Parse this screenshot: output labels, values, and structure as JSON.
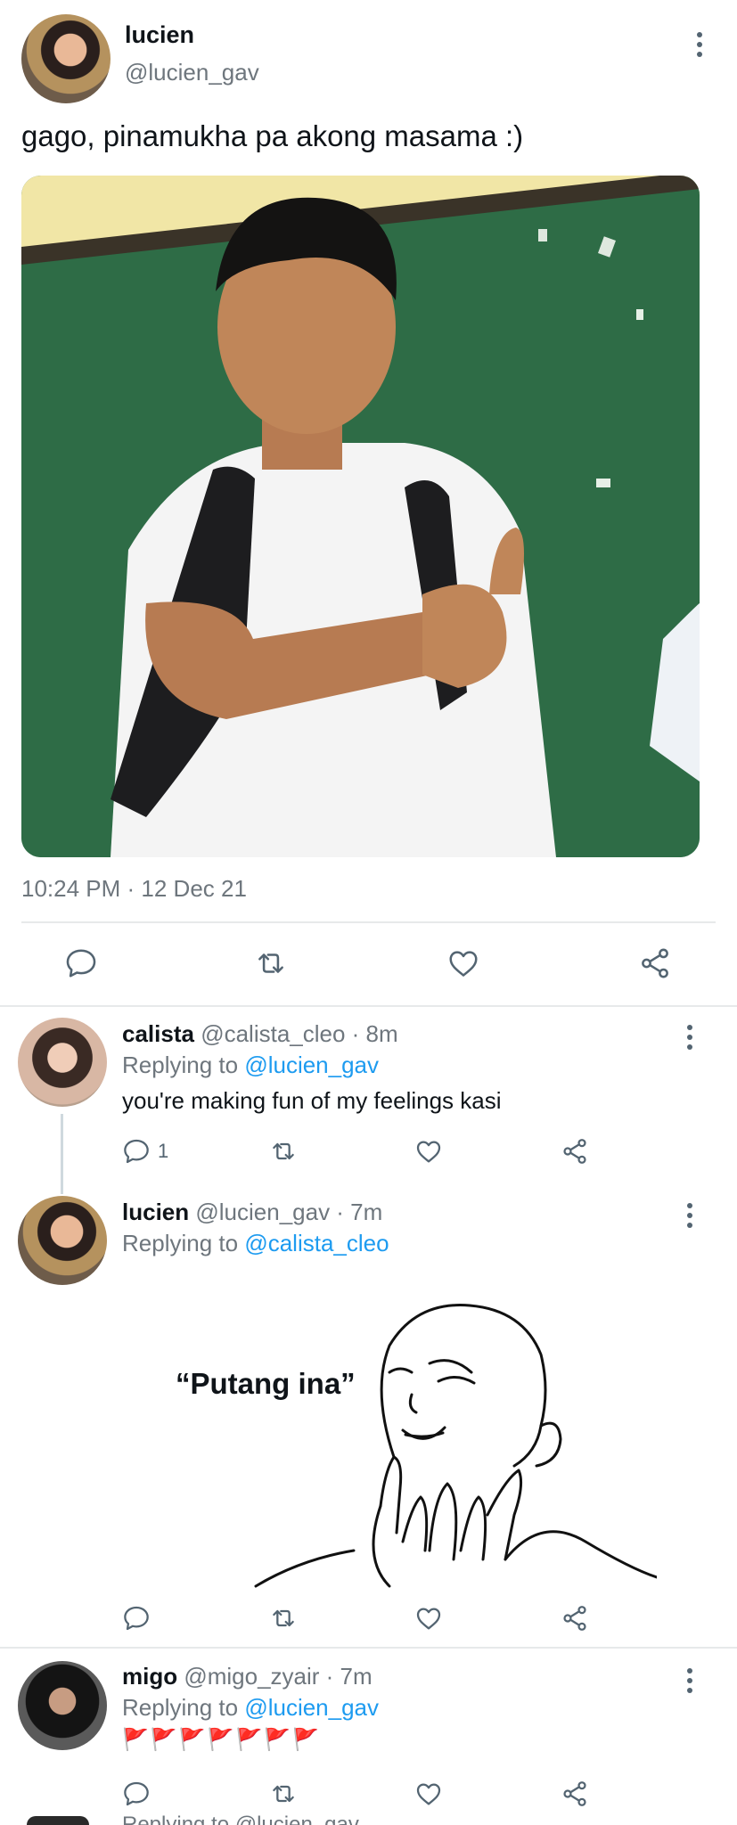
{
  "main_tweet": {
    "display_name": "lucien",
    "handle": "@lucien_gav",
    "text": "gago, pinamukha pa akong masama :)",
    "timestamp": "10:24 PM · 12 Dec 21"
  },
  "replies": [
    {
      "display_name": "calista",
      "meta": "@calista_cleo · 8m",
      "replying_prefix": "Replying to",
      "replying_to": "@lucien_gav",
      "text": "you're making fun of my feelings kasi",
      "reply_count": "1"
    },
    {
      "display_name": "lucien",
      "meta": "@lucien_gav · 7m",
      "replying_prefix": "Replying to",
      "replying_to": "@calista_cleo",
      "meme_caption": "“Putang ina”"
    },
    {
      "display_name": "migo",
      "meta": "@migo_zyair · 7m",
      "replying_prefix": "Replying to",
      "replying_to": "@lucien_gav",
      "flags": "🚩🚩🚩🚩🚩🚩🚩"
    }
  ],
  "partial_reply": {
    "text": "Replying to @lucien_gav"
  },
  "colors": {
    "link": "#1d9bf0",
    "muted": "#6e767d",
    "icon": "#536471",
    "divider": "#e7e9ea"
  },
  "icons": [
    "comment-icon",
    "retweet-icon",
    "like-icon",
    "share-icon",
    "more-icon"
  ]
}
